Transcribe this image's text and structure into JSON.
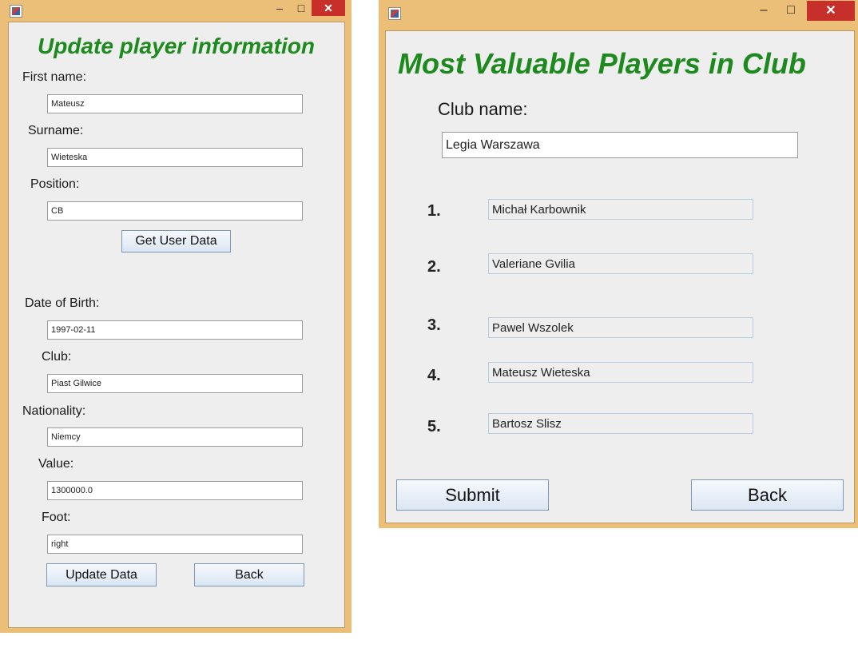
{
  "update_window": {
    "title": "Update player information",
    "fields": [
      {
        "label": "First name:",
        "value": "Mateusz"
      },
      {
        "label": "Surname:",
        "value": "Wieteska"
      },
      {
        "label": "Position:",
        "value": "CB"
      },
      {
        "label": "Date of Birth:",
        "value": "1997-02-11"
      },
      {
        "label": "Club:",
        "value": "Piast Gilwice"
      },
      {
        "label": "Nationality:",
        "value": "Niemcy"
      },
      {
        "label": "Value:",
        "value": "1300000.0"
      },
      {
        "label": "Foot:",
        "value": "right"
      }
    ],
    "get_data_label": "Get User Data",
    "update_label": "Update Data",
    "back_label": "Back",
    "minimize": "–",
    "maximize": "□",
    "close": "✕"
  },
  "mvp_window": {
    "title": "Most Valuable Players in Club",
    "club_label": "Club name:",
    "club_value": "Legia Warszawa",
    "players": [
      {
        "rank": "1.",
        "name": "Michał Karbownik"
      },
      {
        "rank": "2.",
        "name": "Valeriane Gvilia"
      },
      {
        "rank": "3.",
        "name": "Pawel Wszolek"
      },
      {
        "rank": "4.",
        "name": "Mateusz Wieteska"
      },
      {
        "rank": "5.",
        "name": "Bartosz Slisz"
      }
    ],
    "submit_label": "Submit",
    "back_label": "Back",
    "minimize": "–",
    "maximize": "□",
    "close": "✕"
  }
}
